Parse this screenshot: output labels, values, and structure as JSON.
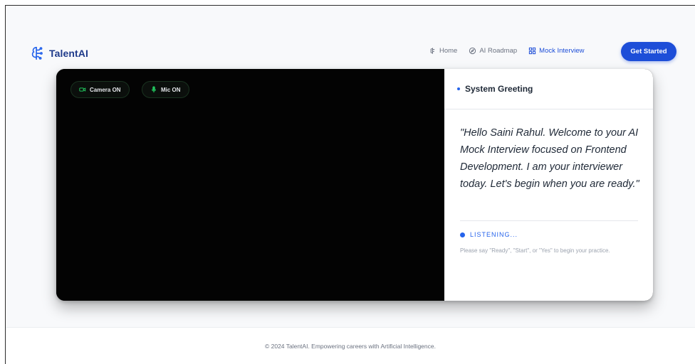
{
  "brand": {
    "name": "TalentAI",
    "icon": "brain-circuit-icon"
  },
  "nav": {
    "items": [
      {
        "label": "Home",
        "icon": "brain-icon",
        "active": false
      },
      {
        "label": "AI Roadmap",
        "icon": "compass-icon",
        "active": false
      },
      {
        "label": "Mock Interview",
        "icon": "grid-icon",
        "active": true
      }
    ],
    "cta_label": "Get Started"
  },
  "video": {
    "camera_label": "Camera ON",
    "mic_label": "Mic ON"
  },
  "panel": {
    "title": "System Greeting",
    "greeting": "\"Hello Saini Rahul. Welcome to your AI Mock Interview focused on Frontend Development. I am your interviewer today. Let's begin when you are ready.\"",
    "status": "LISTENING...",
    "hint": "Please say \"Ready\", \"Start\", or \"Yes\" to begin your practice."
  },
  "footer": {
    "text": "© 2024 TalentAI. Empowering careers with Artificial Intelligence."
  },
  "colors": {
    "accent": "#1d4ed8",
    "status": "#2563eb",
    "chip_green": "#22c55e"
  }
}
